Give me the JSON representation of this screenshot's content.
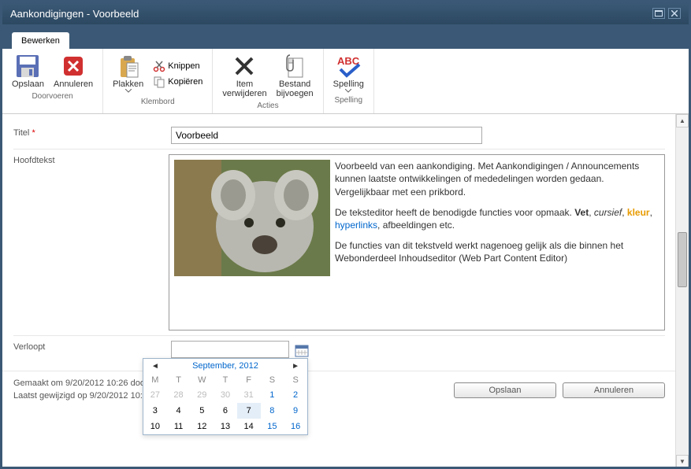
{
  "titlebar": {
    "text": "Aankondigingen - Voorbeeld"
  },
  "ribbon": {
    "tab": "Bewerken",
    "groups": {
      "doorvoeren": {
        "label": "Doorvoeren",
        "save": "Opslaan",
        "cancel": "Annuleren"
      },
      "klembord": {
        "label": "Klembord",
        "paste": "Plakken",
        "cut": "Knippen",
        "copy": "Kopiëren"
      },
      "acties": {
        "label": "Acties",
        "delete": "Item\nverwijderen",
        "attach": "Bestand\nbijvoegen"
      },
      "spelling": {
        "label": "Spelling",
        "spelling": "Spelling"
      }
    }
  },
  "form": {
    "title_label": "Titel",
    "title_value": "Voorbeeld",
    "body_label": "Hoofdtekst",
    "body": {
      "p1a": "Voorbeeld van een aankondiging. Met Aankondigingen / Announcements kunnen laatste ontwikkelingen of mededelingen worden gedaan.",
      "p1b": "Vergelijkbaar met een prikbord.",
      "p2a": "De teksteditor heeft de benodigde functies voor opmaak. ",
      "p2_bold": "Vet",
      "p2_sep1": ", ",
      "p2_italic": "cursief",
      "p2_sep2": ", ",
      "p2_color": "kleur",
      "p2_sep3": ", ",
      "p2_link": "hyperlinks",
      "p2b": ", afbeeldingen etc.",
      "p3": "De functies van dit tekstveld werkt nagenoeg gelijk als die binnen het Webonderdeel Inhoudseditor (Web Part Content Editor)"
    },
    "expires_label": "Verloopt",
    "expires_value": ""
  },
  "meta": {
    "line1": "Gemaakt om 9/20/2012 10:26 doo",
    "line2": "Laatst gewijzigd op 9/20/2012 10:"
  },
  "buttons": {
    "save": "Opslaan",
    "cancel": "Annuleren"
  },
  "datepicker": {
    "title": "September, 2012",
    "dow": [
      "M",
      "T",
      "W",
      "T",
      "F",
      "S",
      "S"
    ],
    "weeks": [
      [
        {
          "d": 27,
          "o": 1
        },
        {
          "d": 28,
          "o": 1
        },
        {
          "d": 29,
          "o": 1
        },
        {
          "d": 30,
          "o": 1
        },
        {
          "d": 31,
          "o": 1
        },
        {
          "d": 1,
          "w": 1
        },
        {
          "d": 2,
          "w": 1
        }
      ],
      [
        {
          "d": 3
        },
        {
          "d": 4
        },
        {
          "d": 5
        },
        {
          "d": 6
        },
        {
          "d": 7,
          "c": 1
        },
        {
          "d": 8,
          "w": 1
        },
        {
          "d": 9,
          "w": 1
        }
      ],
      [
        {
          "d": 10
        },
        {
          "d": 11
        },
        {
          "d": 12
        },
        {
          "d": 13
        },
        {
          "d": 14
        },
        {
          "d": 15,
          "w": 1
        },
        {
          "d": 16,
          "w": 1
        }
      ]
    ]
  }
}
